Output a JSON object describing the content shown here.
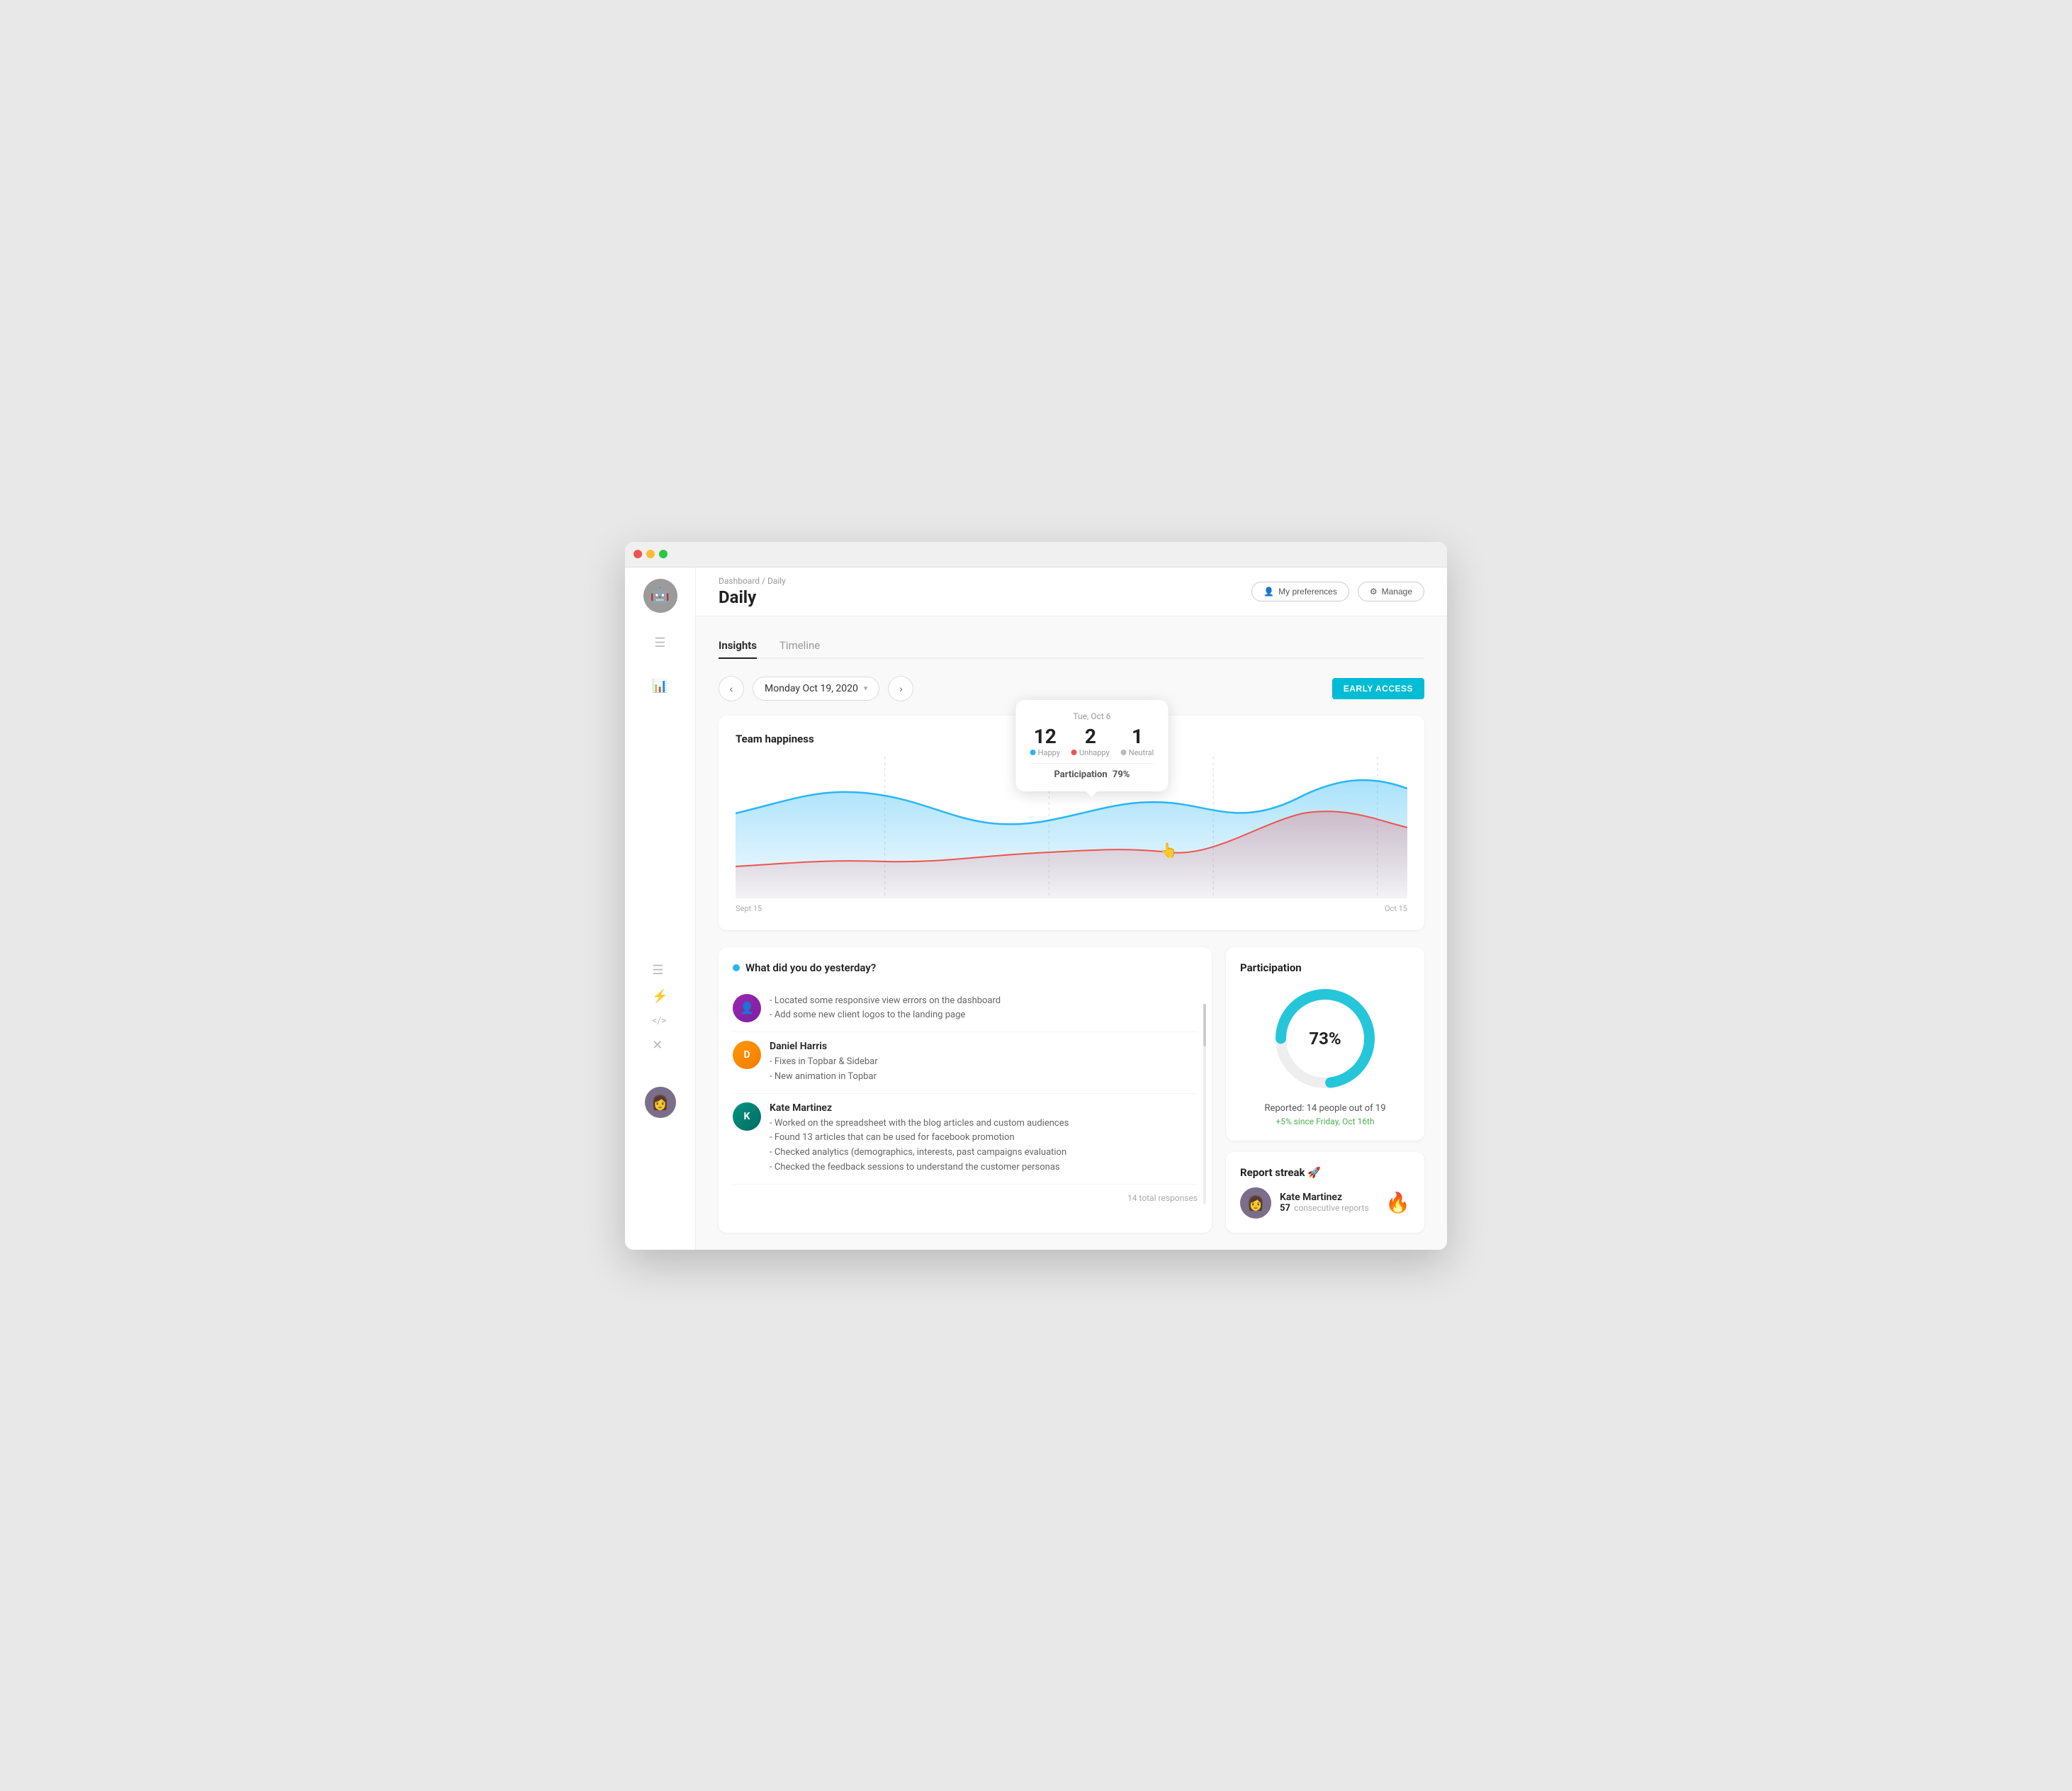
{
  "window": {
    "titlebar": {
      "dots": [
        "red",
        "yellow",
        "green"
      ]
    }
  },
  "breadcrumb": "Dashboard / Daily",
  "page_title": "Daily",
  "topbar": {
    "preferences_label": "My preferences",
    "manage_label": "Manage"
  },
  "tabs": [
    {
      "label": "Insights",
      "active": true
    },
    {
      "label": "Timeline",
      "active": false
    }
  ],
  "date_nav": {
    "current_date": "Monday Oct 19, 2020",
    "prev_icon": "‹",
    "next_icon": "›",
    "early_access": "EARLY ACCESS"
  },
  "chart": {
    "title": "Team happiness",
    "x_start": "Sept 15",
    "x_end": "Oct 15",
    "tooltip": {
      "date": "Tue, Oct 6",
      "happy_num": "12",
      "unhappy_num": "2",
      "neutral_num": "1",
      "happy_label": "Happy",
      "unhappy_label": "Unhappy",
      "neutral_label": "Neutral",
      "participation_label": "Participation",
      "participation_value": "79%"
    }
  },
  "responses": {
    "header": "What did you do yesterday?",
    "items": [
      {
        "name": "",
        "avatar_initials": "👤",
        "lines": [
          "- Located some responsive view errors on the dashboard",
          "- Add some new client logos to the landing page"
        ]
      },
      {
        "name": "Daniel Harris",
        "avatar_initials": "D",
        "lines": [
          "- Fixes in Topbar & Sidebar",
          "- New animation in Topbar"
        ]
      },
      {
        "name": "Kate Martinez",
        "avatar_initials": "K",
        "lines": [
          "- Worked on the spreadsheet with the blog articles and custom audiences",
          "- Found 13 articles that can be used for facebook promotion",
          "- Checked analytics (demographics, interests, past campaigns evaluation",
          "- Checked the feedback sessions to understand the customer personas"
        ]
      }
    ],
    "footer": "14 total responses"
  },
  "participation": {
    "title": "Participation",
    "percentage": "73%",
    "reported_label": "Reported: 14 people out of 19",
    "change_label": "+5% since Friday, Oct 16th"
  },
  "streak": {
    "title": "Report streak 🚀",
    "person_name": "Kate Martinez",
    "person_count": "57",
    "count_label": "consecutive reports",
    "fire_emoji": "🔥"
  },
  "sidebar": {
    "top_avatar_emoji": "🤖",
    "icons": [
      "☰",
      "☰",
      "📊",
      "☰",
      "⚡",
      "⟨/⟩",
      "✕"
    ],
    "bottom_avatar_emoji": "👩"
  }
}
